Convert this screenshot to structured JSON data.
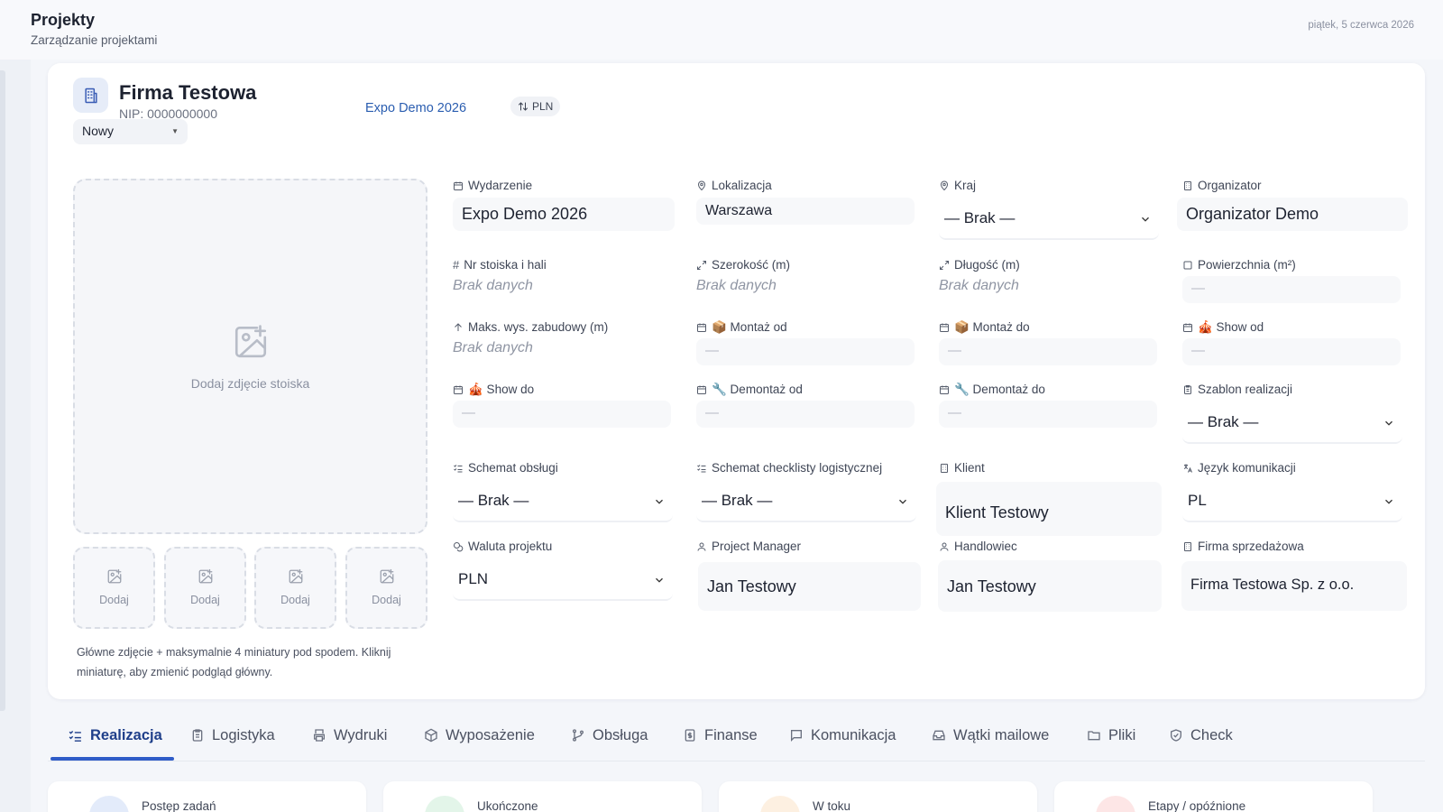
{
  "header": {
    "title": "Projekty",
    "subtitle": "Zarządzanie projektami",
    "date": "piątek, 5 czerwca 2026"
  },
  "company": {
    "name": "Firma Testowa",
    "nip": "NIP: 0000000000",
    "status": "Nowy",
    "event_link": "Expo Demo 2026",
    "currency_badge": "PLN"
  },
  "photos": {
    "main_label": "Dodaj zdjęcie stoiska",
    "thumb_label": "Dodaj",
    "hint": "Główne zdjęcie + maksymalnie 4 miniatury pod spodem. Kliknij miniaturę, aby zmienić podgląd główny."
  },
  "fields": {
    "wydarzenie": {
      "label": "Wydarzenie",
      "value": "Expo Demo 2026"
    },
    "lokalizacja": {
      "label": "Lokalizacja",
      "value": "Warszawa"
    },
    "kraj": {
      "label": "Kraj",
      "value": "— Brak —"
    },
    "organizator": {
      "label": "Organizator",
      "value": "Organizator Demo"
    },
    "nr_stoiska": {
      "label": "Nr stoiska i hali",
      "value": "Brak danych"
    },
    "szerokosc": {
      "label": "Szerokość (m)",
      "value": "Brak danych"
    },
    "dlugosc": {
      "label": "Długość (m)",
      "value": "Brak danych"
    },
    "powierzchnia": {
      "label": "Powierzchnia (m²)",
      "value": "—"
    },
    "maks_wys": {
      "label": "Maks. wys. zabudowy (m)",
      "value": "Brak danych"
    },
    "montaz_od": {
      "label": "📦 Montaż od",
      "value": "—"
    },
    "montaz_do": {
      "label": "📦 Montaż do",
      "value": "—"
    },
    "show_od": {
      "label": "🎪 Show od",
      "value": "—"
    },
    "show_do": {
      "label": "🎪 Show do",
      "value": "—"
    },
    "demontaz_od": {
      "label": "🔧 Demontaż od",
      "value": "—"
    },
    "demontaz_do": {
      "label": "🔧 Demontaż do",
      "value": "—"
    },
    "szablon": {
      "label": "Szablon realizacji",
      "value": "— Brak —"
    },
    "schemat_obslugi": {
      "label": "Schemat obsługi",
      "value": "— Brak —"
    },
    "schemat_checklisty": {
      "label": "Schemat checklisty logistycznej",
      "value": "— Brak —"
    },
    "klient": {
      "label": "Klient",
      "value": "Klient Testowy"
    },
    "jezyk": {
      "label": "Język komunikacji",
      "value": "PL"
    },
    "waluta": {
      "label": "Waluta projektu",
      "value": "PLN"
    },
    "project_manager": {
      "label": "Project Manager",
      "value": "Jan Testowy"
    },
    "handlowiec": {
      "label": "Handlowiec",
      "value": "Jan Testowy"
    },
    "firma_sprzedazowa": {
      "label": "Firma sprzedażowa",
      "value": "Firma Testowa Sp. z o.o."
    }
  },
  "tabs": [
    {
      "label": "Realizacja",
      "icon": "list-check-icon",
      "active": true
    },
    {
      "label": "Logistyka",
      "icon": "clipboard-icon"
    },
    {
      "label": "Wydruki",
      "icon": "printer-icon"
    },
    {
      "label": "Wyposażenie",
      "icon": "box-icon"
    },
    {
      "label": "Obsługa",
      "icon": "git-branch-icon"
    },
    {
      "label": "Finanse",
      "icon": "dollar-file-icon"
    },
    {
      "label": "Komunikacja",
      "icon": "message-icon"
    },
    {
      "label": "Wątki mailowe",
      "icon": "inbox-icon"
    },
    {
      "label": "Pliki",
      "icon": "folder-icon"
    },
    {
      "label": "Check",
      "icon": "shield-check-icon"
    }
  ],
  "stats": [
    {
      "label": "Postęp zadań",
      "color": "#e3ebfa"
    },
    {
      "label": "Ukończone",
      "color": "#e3f5e9"
    },
    {
      "label": "W toku",
      "color": "#fdf0e1"
    },
    {
      "label": "Etapy / opóźnione",
      "color": "#fde6e6"
    }
  ]
}
